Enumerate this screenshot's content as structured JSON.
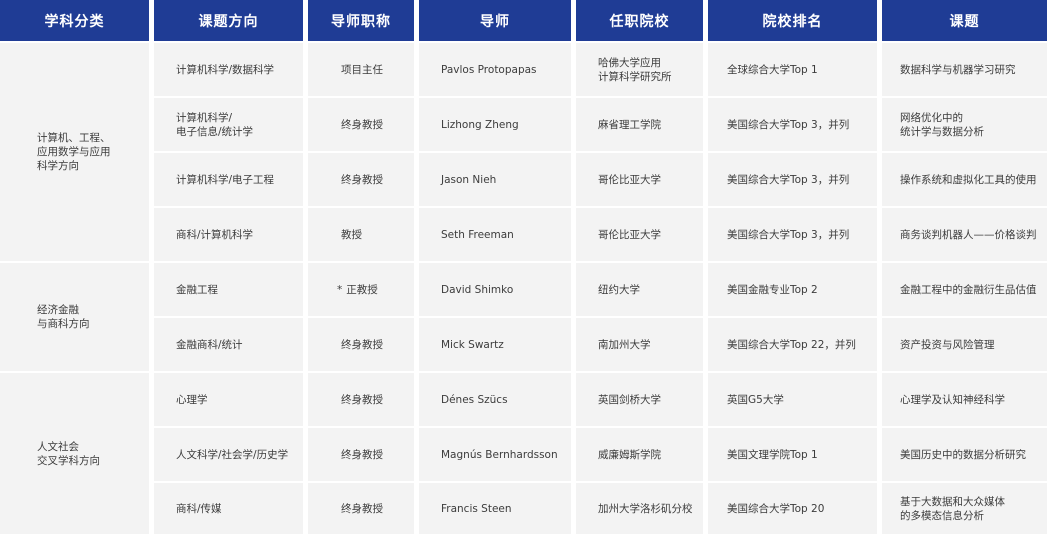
{
  "headers": [
    "学科分类",
    "课题方向",
    "导师职称",
    "导师",
    "任职院校",
    "院校排名",
    "课题"
  ],
  "categories": [
    {
      "label": "计算机、工程、\n应用数学与应用\n科学方向"
    },
    {
      "label": "经济金融\n与商科方向"
    },
    {
      "label": "人文社会\n交叉学科方向"
    }
  ],
  "rows": [
    {
      "direction": "计算机科学/数据科学",
      "role": "项目主任",
      "star": "",
      "mentor": "Pavlos Protopapas",
      "school": "哈佛大学应用\n计算科学研究所",
      "ranking": "全球综合大学Top 1",
      "topic": "数据科学与机器学习研究"
    },
    {
      "direction": "计算机科学/\n电子信息/统计学",
      "role": "终身教授",
      "star": "",
      "mentor": "Lizhong Zheng",
      "school": "麻省理工学院",
      "ranking": "美国综合大学Top 3，并列",
      "topic": "网络优化中的\n统计学与数据分析"
    },
    {
      "direction": "计算机科学/电子工程",
      "role": "终身教授",
      "star": "",
      "mentor": "Jason Nieh",
      "school": "哥伦比亚大学",
      "ranking": "美国综合大学Top 3，并列",
      "topic": "操作系统和虚拟化工具的使用"
    },
    {
      "direction": "商科/计算机科学",
      "role": "教授",
      "star": "",
      "mentor": "Seth Freeman",
      "school": "哥伦比亚大学",
      "ranking": "美国综合大学Top 3，并列",
      "topic": "商务谈判机器人——价格谈判"
    },
    {
      "direction": "金融工程",
      "role": "正教授",
      "star": "*",
      "mentor": "David Shimko",
      "school": "纽约大学",
      "ranking": "美国金融专业Top 2",
      "topic": "金融工程中的金融衍生品估值"
    },
    {
      "direction": "金融商科/统计",
      "role": "终身教授",
      "star": "",
      "mentor": "Mick Swartz",
      "school": "南加州大学",
      "ranking": "美国综合大学Top 22，并列",
      "topic": "资产投资与风险管理"
    },
    {
      "direction": "心理学",
      "role": "终身教授",
      "star": "",
      "mentor": "Dénes Szücs",
      "school": "英国剑桥大学",
      "ranking": "英国G5大学",
      "topic": "心理学及认知神经科学"
    },
    {
      "direction": "人文科学/社会学/历史学",
      "role": "终身教授",
      "star": "",
      "mentor": "Magnús Bernhardsson",
      "school": "威廉姆斯学院",
      "ranking": "美国文理学院Top 1",
      "topic": "美国历史中的数据分析研究"
    },
    {
      "direction": "商科/传媒",
      "role": "终身教授",
      "star": "",
      "mentor": "Francis Steen",
      "school": "加州大学洛杉矶分校",
      "ranking": "美国综合大学Top 20",
      "topic": "基于大数据和大众媒体\n的多模态信息分析"
    }
  ]
}
